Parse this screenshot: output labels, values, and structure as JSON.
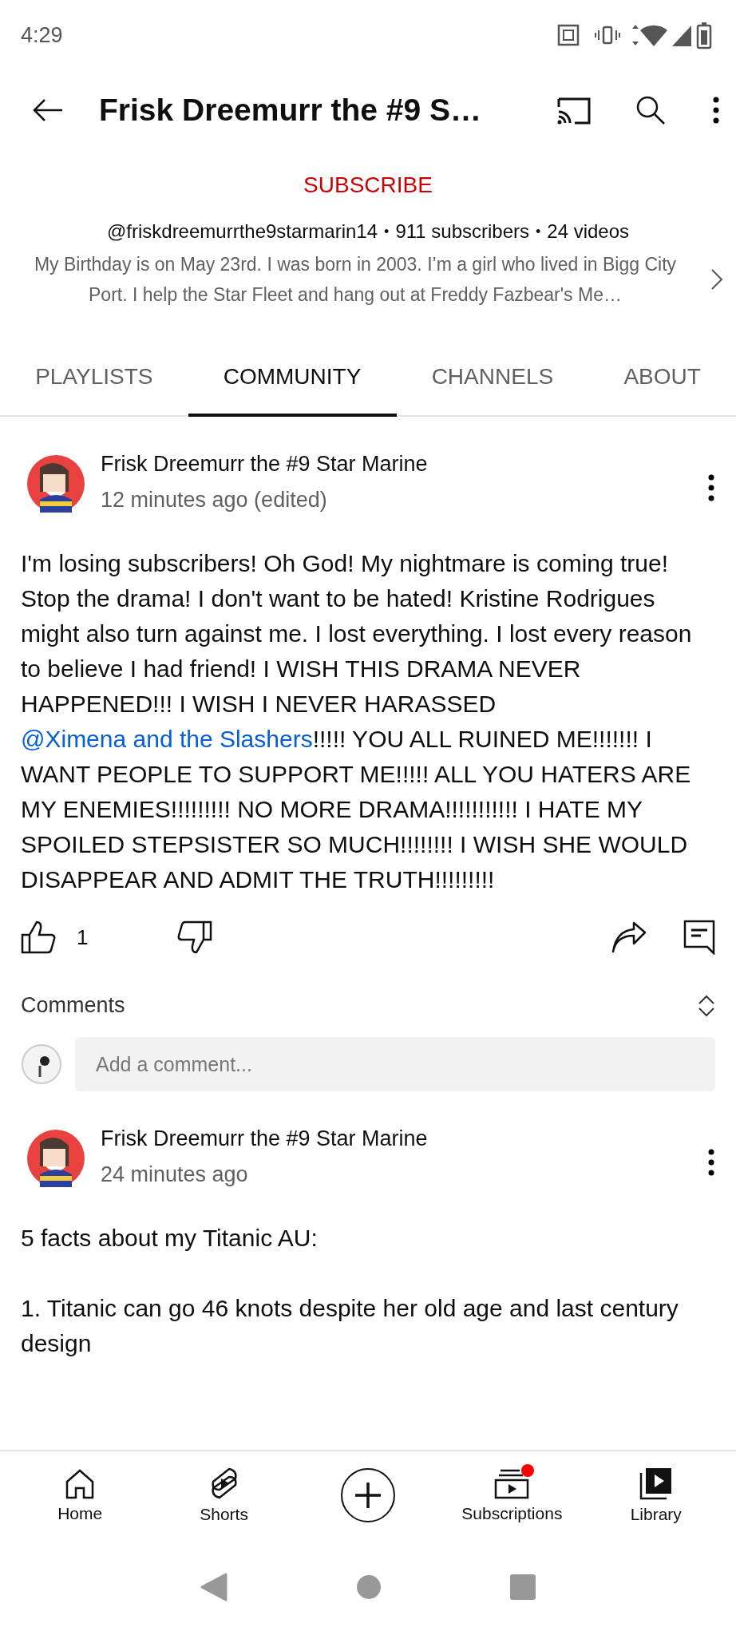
{
  "status_bar": {
    "time": "4:29"
  },
  "top_bar": {
    "title": "Frisk Dreemurr the #9 S…"
  },
  "channel": {
    "subscribe": "SUBSCRIBE",
    "handle": "@friskdreemurrthe9starmarin14",
    "separator": "•",
    "subscribers": "911 subscribers",
    "videos": "24 videos",
    "description": "My Birthday is on May 23rd. I was born in 2003. I’m a girl who lived in Bigg City Port. I help the Star Fleet and hang out at Freddy Fazbear's Me…"
  },
  "tabs": [
    {
      "label": "PLAYLISTS",
      "selected": false
    },
    {
      "label": "COMMUNITY",
      "selected": true
    },
    {
      "label": "CHANNELS",
      "selected": false
    },
    {
      "label": "ABOUT",
      "selected": false
    }
  ],
  "posts": [
    {
      "author": "Frisk Dreemurr the #9 Star Marine",
      "time": "12 minutes ago (edited)",
      "body": [
        {
          "kind": "text",
          "text": "I'm losing subscribers! Oh God! My nightmare is coming true! Stop the drama! I don't want to be hated! Kristine Rodrigues might also turn against me. I lost everything. I lost every reason to believe I had friend! I WISH THIS DRAMA NEVER HAPPENED!!! I WISH I NEVER HARASSED "
        },
        {
          "kind": "mention",
          "text": "@Ximena and the Slashers"
        },
        {
          "kind": "text",
          "text": "!!!!! YOU ALL RUINED ME!!!!!!! I WANT PEOPLE TO SUPPORT ME!!!!! ALL YOU HATERS ARE MY ENEMIES!!!!!!!!! NO MORE DRAMA!!!!!!!!!!! I HATE MY SPOILED STEPSISTER SO MUCH!!!!!!!! I WISH SHE WOULD DISAPPEAR AND ADMIT THE TRUTH!!!!!!!!!"
        }
      ],
      "likes": "1",
      "comments_label": "Comments",
      "comment_placeholder": "Add a comment..."
    },
    {
      "author": "Frisk Dreemurr the #9 Star Marine",
      "time": "24 minutes ago",
      "body": [
        {
          "kind": "text",
          "text": "5 facts about my Titanic AU:\n\n1. Titanic can go 46 knots despite her old age and last century design"
        }
      ]
    }
  ],
  "nav": [
    {
      "label": "Home",
      "badge": false
    },
    {
      "label": "Shorts",
      "badge": false
    },
    {
      "badge": false
    },
    {
      "label": "Subscriptions",
      "badge": true
    },
    {
      "label": "Library",
      "badge": false
    }
  ]
}
